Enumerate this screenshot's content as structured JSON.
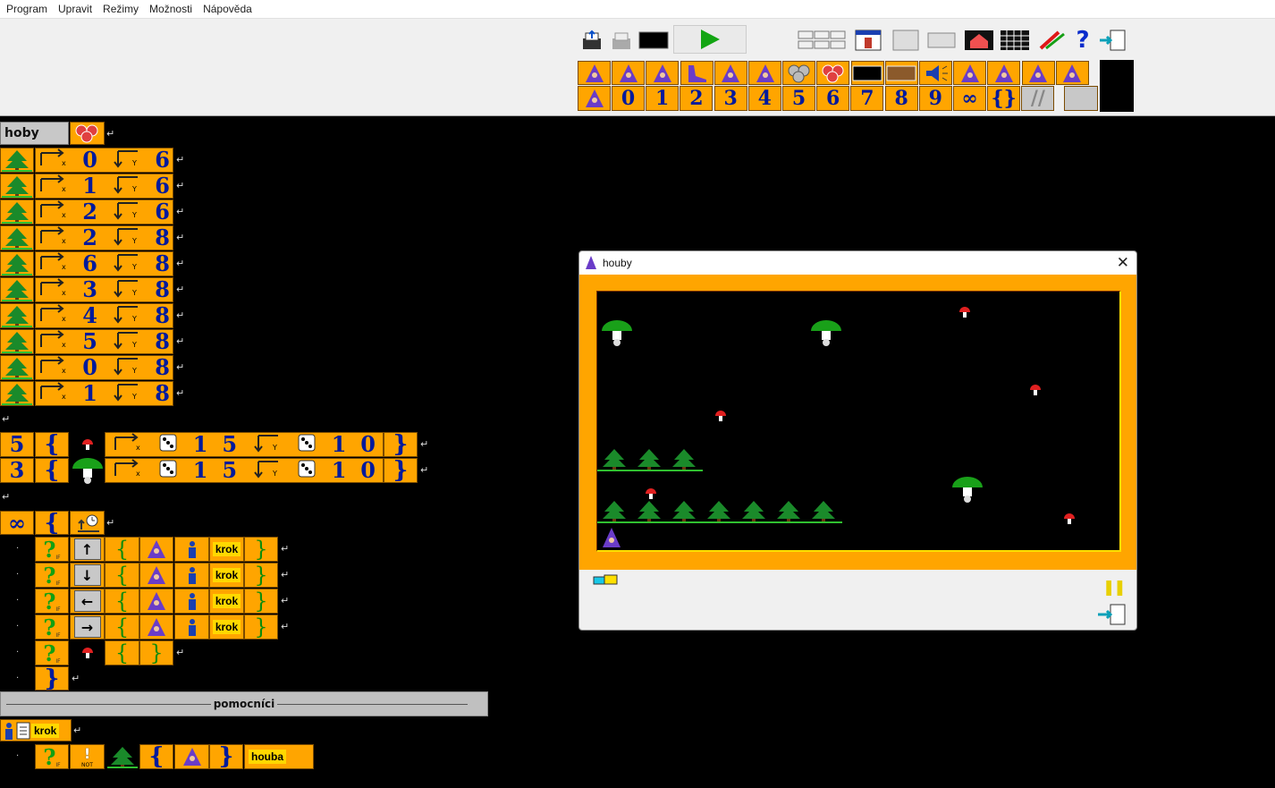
{
  "menu": [
    "Program",
    "Upravit",
    "Režimy",
    "Možnosti",
    "Nápověda"
  ],
  "palette_numbers": [
    "0",
    "1",
    "2",
    "3",
    "4",
    "5",
    "6",
    "7",
    "8",
    "9",
    "∞",
    "{}",
    "//"
  ],
  "object_header": {
    "name": "hoby"
  },
  "tree_rows": [
    {
      "x": "0",
      "y": "6"
    },
    {
      "x": "1",
      "y": "6"
    },
    {
      "x": "2",
      "y": "6"
    },
    {
      "x": "2",
      "y": "8"
    },
    {
      "x": "6",
      "y": "8"
    },
    {
      "x": "3",
      "y": "8"
    },
    {
      "x": "4",
      "y": "8"
    },
    {
      "x": "5",
      "y": "8"
    },
    {
      "x": "0",
      "y": "8"
    },
    {
      "x": "1",
      "y": "8"
    }
  ],
  "repeat_rows": [
    {
      "count": "5",
      "open": "{",
      "xa": "1",
      "xb": "5",
      "ya": "1",
      "yb": "0",
      "close": "}"
    },
    {
      "count": "3",
      "open": "{",
      "xa": "1",
      "xb": "5",
      "ya": "1",
      "yb": "0",
      "close": "}"
    }
  ],
  "loop": {
    "symbol": "∞",
    "open": "{"
  },
  "conditions": [
    {
      "arrow": "↑",
      "open": "{",
      "action": "krok",
      "close": "}"
    },
    {
      "arrow": "↓",
      "open": "{",
      "action": "krok",
      "close": "}"
    },
    {
      "arrow": "←",
      "open": "{",
      "action": "krok",
      "close": "}"
    },
    {
      "arrow": "→",
      "open": "{",
      "action": "krok",
      "close": "}"
    }
  ],
  "last_condition": {
    "open": "{",
    "close": "}"
  },
  "loop_close": "}",
  "separator_label": "pomocníci",
  "helper": {
    "name": "krok"
  },
  "helper_row": {
    "open": "{",
    "close": "}",
    "label": "houba"
  },
  "window": {
    "title": "houby"
  },
  "colors": {
    "orange": "#ffa500",
    "blue_text": "#001a9c",
    "field": "#000000"
  }
}
